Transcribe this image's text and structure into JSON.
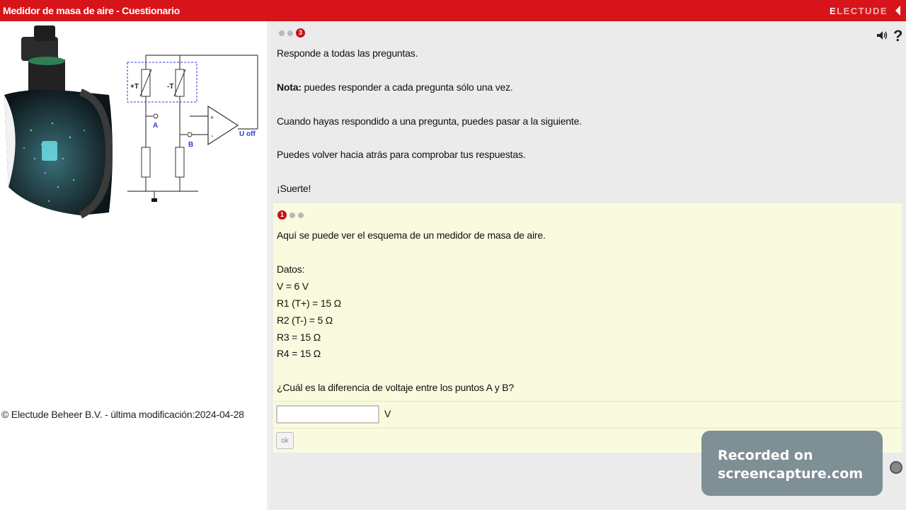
{
  "header": {
    "title": "Medidor de masa de aire - Cuestionario",
    "brand_first": "E",
    "brand_rest": "LECTUDE",
    "accent": "#d7141a"
  },
  "left": {
    "copyright": "© Electude Beheer B.V. - última modificación:2024-04-28",
    "schematic": {
      "plus_t": "+T",
      "minus_t": "-T",
      "point_a": "A",
      "point_b": "B",
      "op_plus": "+",
      "op_minus": "-",
      "output": "U off"
    }
  },
  "intro": {
    "step_active": "3",
    "line1": "Responde a todas las preguntas.",
    "note_label": "Nota:",
    "note_text": " puedes responder a cada pregunta sólo una vez.",
    "line3": "Cuando hayas respondido a una pregunta, puedes pasar a la siguiente.",
    "line4": "Puedes volver hacia atrás para comprobar tus respuestas.",
    "line5": "¡Suerte!"
  },
  "question": {
    "step_active": "1",
    "text": "Aquí se puede ver el esquema de un medidor de masa de aire.",
    "data_label": "Datos:",
    "data": [
      "V = 6 V",
      "R1 (T+) = 15 Ω",
      "R2 (T-) = 5 Ω",
      "R3 = 15 Ω",
      "R4 = 15 Ω"
    ],
    "prompt": "¿Cuál es la diferencia de voltaje entre los puntos A y B?",
    "answer_value": "",
    "unit": "V",
    "ok_label": "ok"
  },
  "toolbar": {
    "help_label": "?"
  },
  "watermark": {
    "line1": "Recorded on",
    "line2": "screencapture.com"
  }
}
